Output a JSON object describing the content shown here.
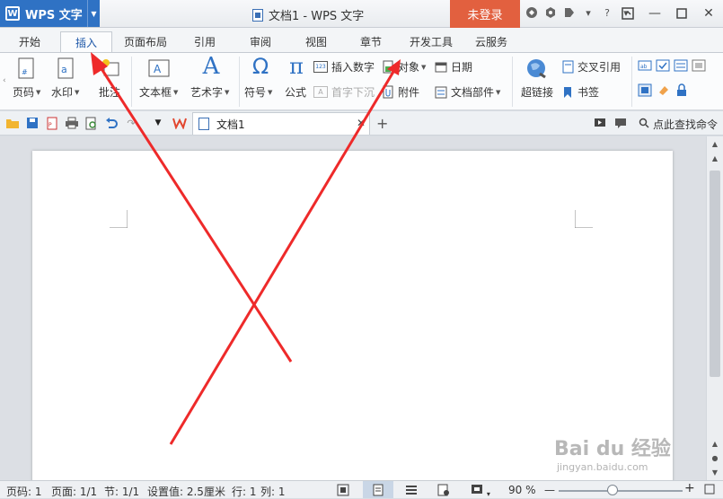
{
  "app": {
    "menu_label": "WPS 文字",
    "window_title": "文档1 - WPS 文字",
    "login_label": "未登录"
  },
  "tabs": [
    "开始",
    "插入",
    "页面布局",
    "引用",
    "审阅",
    "视图",
    "章节",
    "开发工具",
    "云服务"
  ],
  "active_tab": "插入",
  "ribbon": {
    "page_number": "页码",
    "watermark": "水印",
    "comment": "批注",
    "text_box": "文本框",
    "art_text": "艺术字",
    "symbol": "符号",
    "formula": "公式",
    "insert_number": "插入数字",
    "drop_cap": "首字下沉",
    "object": "对象",
    "date": "日期",
    "attachment": "附件",
    "doc_parts": "文档部件",
    "hyperlink": "超链接",
    "cross_ref": "交叉引用",
    "bookmark": "书签"
  },
  "quickbar": {
    "doc_tab_label": "文档1",
    "find_command": "点此查找命令"
  },
  "status": {
    "page_num": "页码: 1",
    "page": "页面: 1/1",
    "section": "节: 1/1",
    "setting": "设置值: 2.5厘米",
    "row": "行: 1",
    "col": "列: 1",
    "zoom": "90 %"
  },
  "watermark_text": {
    "brand": "Bai du 经验",
    "url": "jingyan.baidu.com"
  },
  "colors": {
    "accent": "#2f72c4",
    "login": "#e2603f",
    "arrow": "#ee2a2a"
  }
}
